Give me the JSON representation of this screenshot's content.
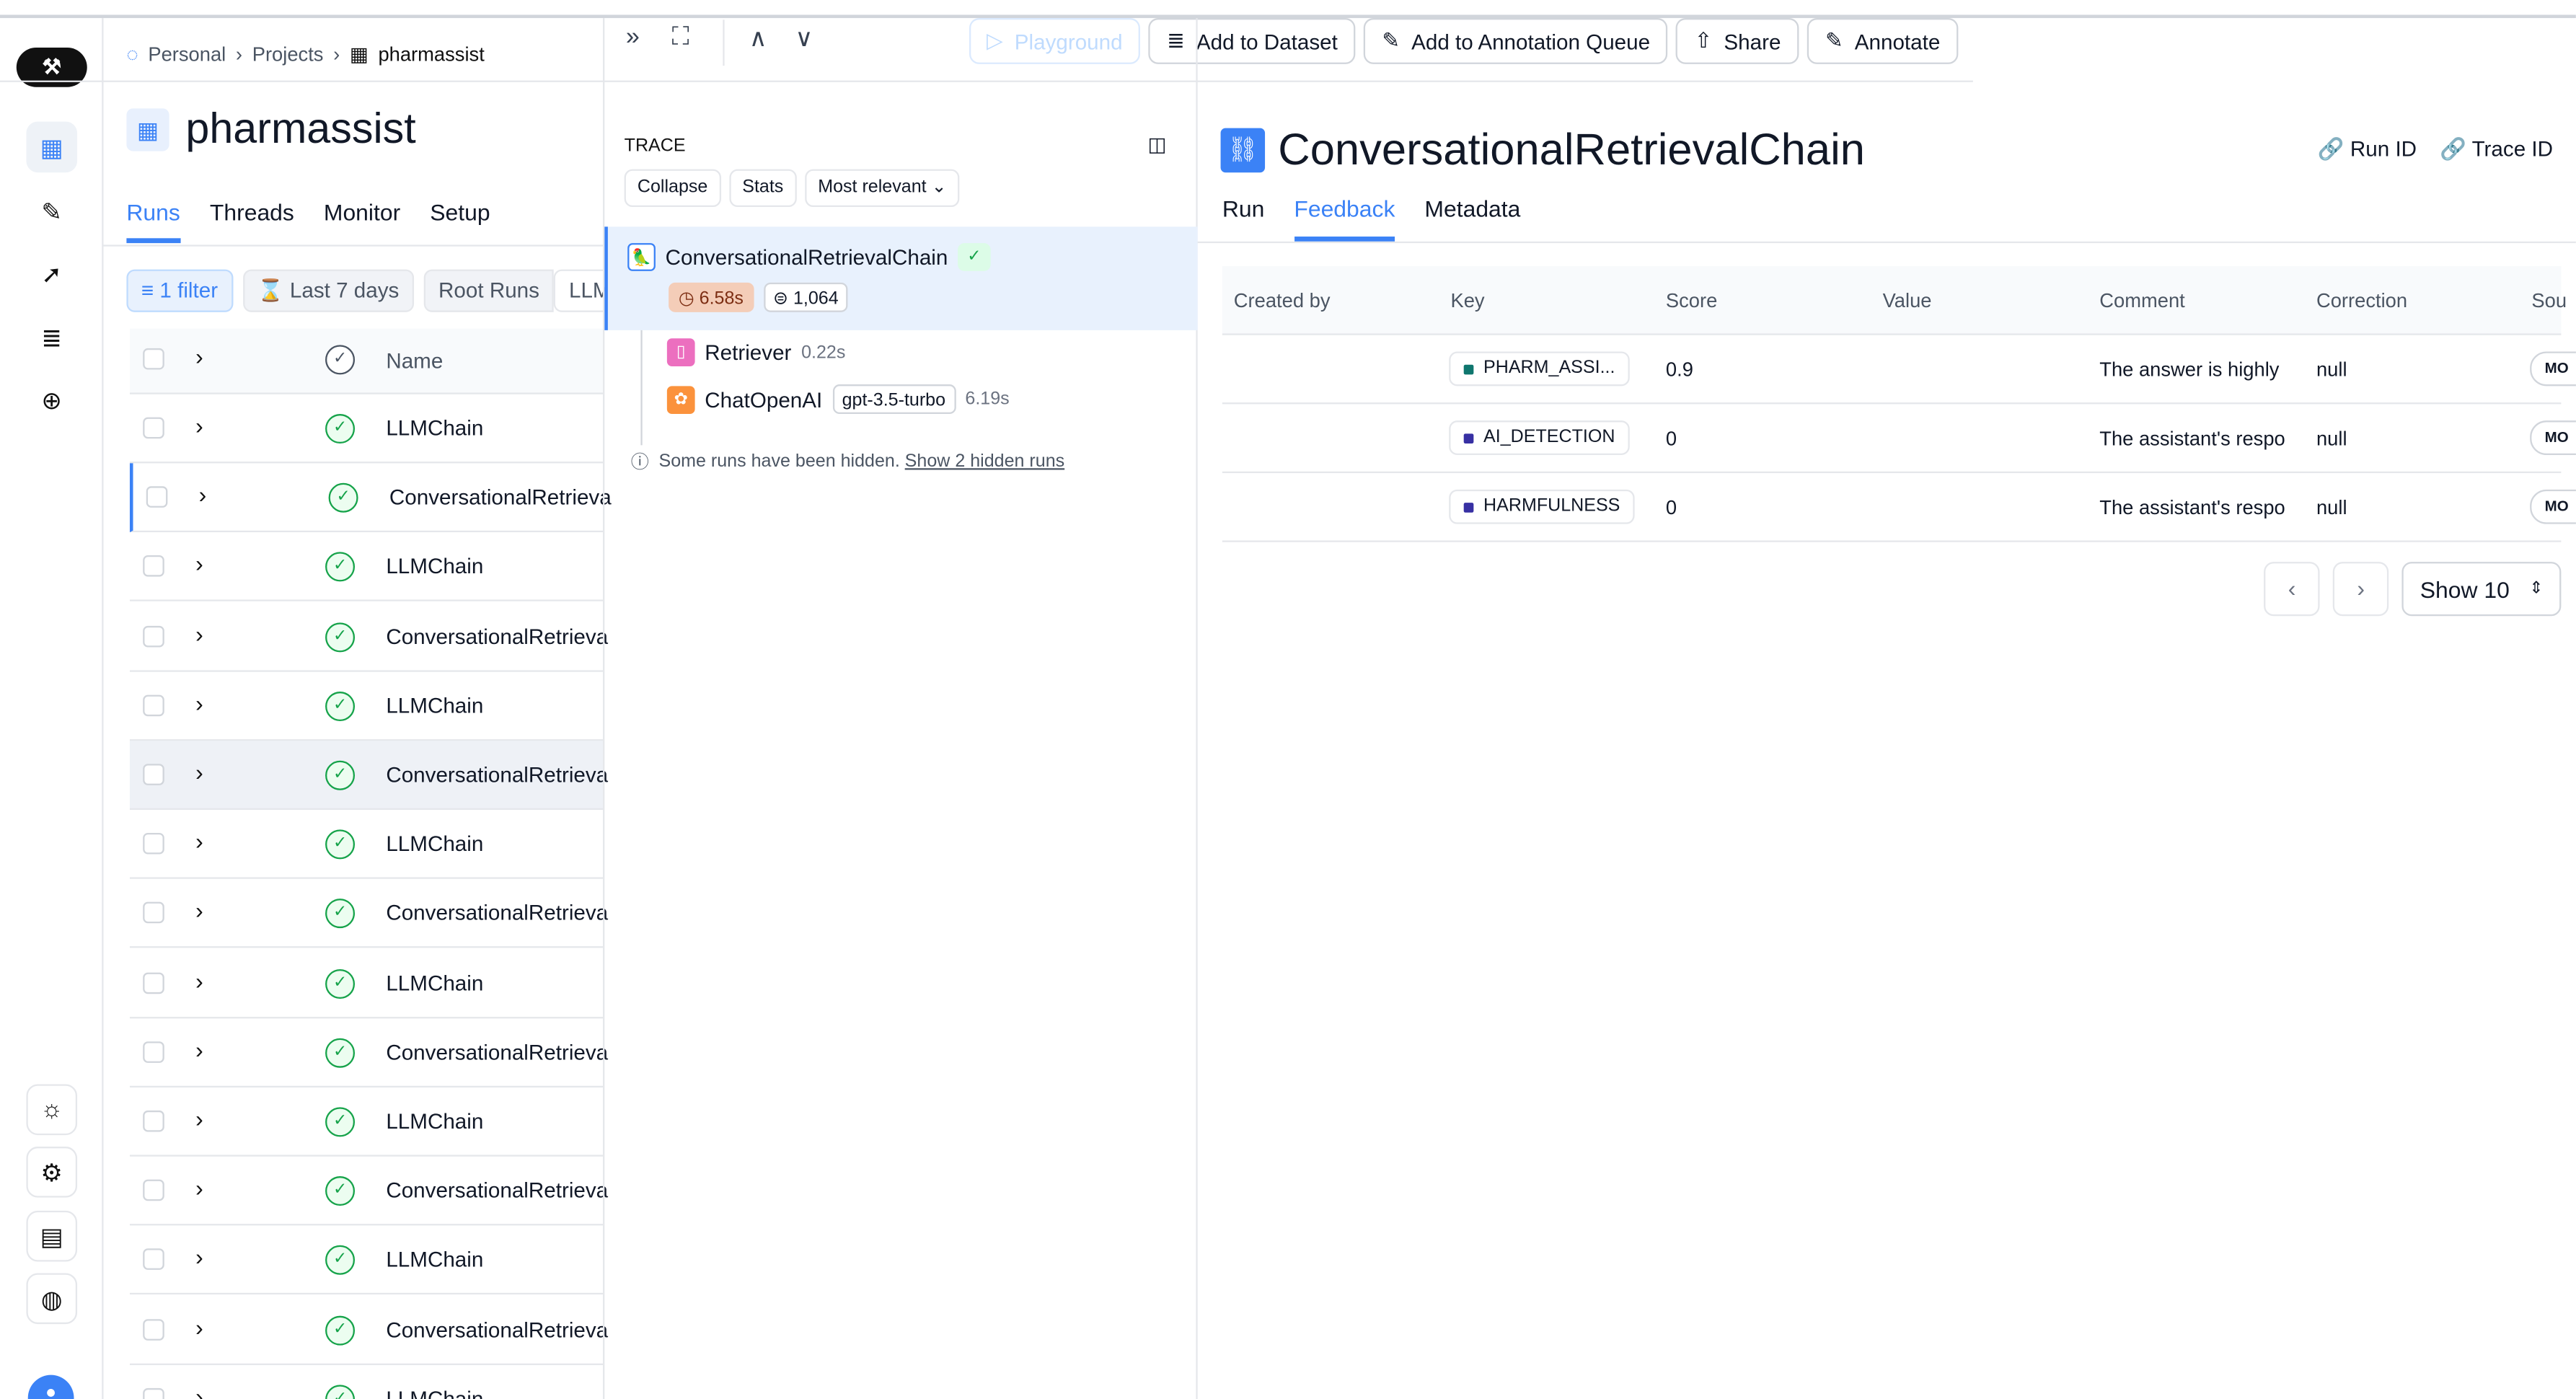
{
  "breadcrumb": {
    "items": [
      "Personal",
      "Projects",
      "pharmassist"
    ]
  },
  "project": {
    "title": "pharmassist",
    "tabs": [
      "Runs",
      "Threads",
      "Monitor",
      "Setup"
    ],
    "active_tab": "Runs"
  },
  "filters": {
    "filter": "1 filter",
    "time": "Last 7 days",
    "root": "Root Runs",
    "llm": "LLM"
  },
  "runs_table": {
    "header_name": "Name",
    "rows": [
      "LLMChain",
      "ConversationalRetrieva",
      "LLMChain",
      "ConversationalRetrieva",
      "LLMChain",
      "ConversationalRetrieva",
      "LLMChain",
      "ConversationalRetrieva",
      "LLMChain",
      "ConversationalRetrieva",
      "LLMChain",
      "ConversationalRetrieva",
      "LLMChain",
      "ConversationalRetrieva",
      "LLMChain"
    ]
  },
  "trace": {
    "label": "TRACE",
    "buttons": {
      "collapse": "Collapse",
      "stats": "Stats",
      "sort": "Most relevant"
    },
    "root": {
      "name": "ConversationalRetrievalChain",
      "latency": "6.58s",
      "tokens": "1,064"
    },
    "children": [
      {
        "name": "Retriever",
        "latency": "0.22s"
      },
      {
        "name": "ChatOpenAI",
        "model": "gpt-3.5-turbo",
        "latency": "6.19s"
      }
    ],
    "hidden_note": "Some runs have been hidden.",
    "hidden_link": "Show 2 hidden runs"
  },
  "actions": {
    "playground": "Playground",
    "add_dataset": "Add to Dataset",
    "add_queue": "Add to Annotation Queue",
    "share": "Share",
    "annotate": "Annotate"
  },
  "run": {
    "title": "ConversationalRetrievalChain",
    "run_id": "Run ID",
    "trace_id": "Trace ID",
    "tabs": [
      "Run",
      "Feedback",
      "Metadata"
    ],
    "active_tab": "Feedback"
  },
  "feedback": {
    "columns": [
      "Created by",
      "Key",
      "Score",
      "Value",
      "Comment",
      "Correction",
      "Sou"
    ],
    "rows": [
      {
        "key": "PHARM_ASSI...",
        "key_color": "#0f766e",
        "score": "0.9",
        "comment": "The answer is highly",
        "correction": "null",
        "source": "MO"
      },
      {
        "key": "AI_DETECTION",
        "key_color": "#3730a3",
        "score": "0",
        "comment": "The assistant's respo",
        "correction": "null",
        "source": "MO"
      },
      {
        "key": "HARMFULNESS",
        "key_color": "#3730a3",
        "score": "0",
        "comment": "The assistant's respo",
        "correction": "null",
        "source": "MO"
      }
    ]
  },
  "pagination": {
    "show": "Show 10"
  },
  "colors": {
    "accent": "#3b82f6",
    "success": "#16a34a"
  }
}
